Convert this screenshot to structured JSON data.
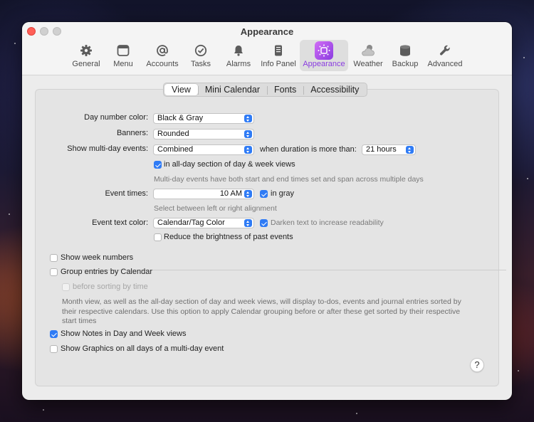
{
  "window": {
    "title": "Appearance"
  },
  "toolbar": [
    {
      "label": "General"
    },
    {
      "label": "Menu"
    },
    {
      "label": "Accounts"
    },
    {
      "label": "Tasks"
    },
    {
      "label": "Alarms"
    },
    {
      "label": "Info Panel"
    },
    {
      "label": "Appearance"
    },
    {
      "label": "Weather"
    },
    {
      "label": "Backup"
    },
    {
      "label": "Advanced"
    }
  ],
  "tabs": [
    {
      "label": "View"
    },
    {
      "label": "Mini Calendar"
    },
    {
      "label": "Fonts"
    },
    {
      "label": "Accessibility"
    }
  ],
  "colors": {
    "accent": "#2f7bf5",
    "selected_tab": "#8a3ce0",
    "close": "#ff5f57"
  },
  "form": {
    "day_number_color": {
      "label": "Day number color:",
      "value": "Black & Gray"
    },
    "banners": {
      "label": "Banners:",
      "value": "Rounded"
    },
    "multi_day": {
      "label": "Show multi-day events:",
      "value": "Combined",
      "duration_label": "when duration is more than:",
      "duration_value": "21 hours"
    },
    "allday_section": {
      "label": "in all-day section of day & week views",
      "checked": true
    },
    "multi_day_hint": "Multi-day events have both start and end times set and span across multiple days",
    "event_times": {
      "label": "Event times:",
      "value": "10 AM",
      "in_gray_label": "in gray",
      "in_gray_checked": true
    },
    "event_times_hint": "Select between left or right alignment",
    "event_text_color": {
      "label": "Event text color:",
      "value": "Calendar/Tag Color",
      "darken_label": "Darken text to increase readability",
      "darken_checked": true
    },
    "reduce_brightness": {
      "label": "Reduce the brightness of past events",
      "checked": false
    }
  },
  "options": {
    "week_numbers": {
      "label": "Show week numbers",
      "checked": false
    },
    "group_entries": {
      "label": "Group entries by Calendar",
      "checked": false
    },
    "before_sorting": {
      "label": "before sorting by time",
      "checked": false
    },
    "group_note": "Month view, as well as the all-day section of day and week views, will display to-dos, events and journal entries sorted by their respective calendars. Use this option to apply Calendar grouping before or after these get sorted by their respective start times",
    "show_notes": {
      "label": "Show Notes in Day and Week views",
      "checked": true
    },
    "show_graphics": {
      "label": "Show Graphics on all days of a multi-day event",
      "checked": false
    }
  },
  "help": {
    "label": "?"
  }
}
